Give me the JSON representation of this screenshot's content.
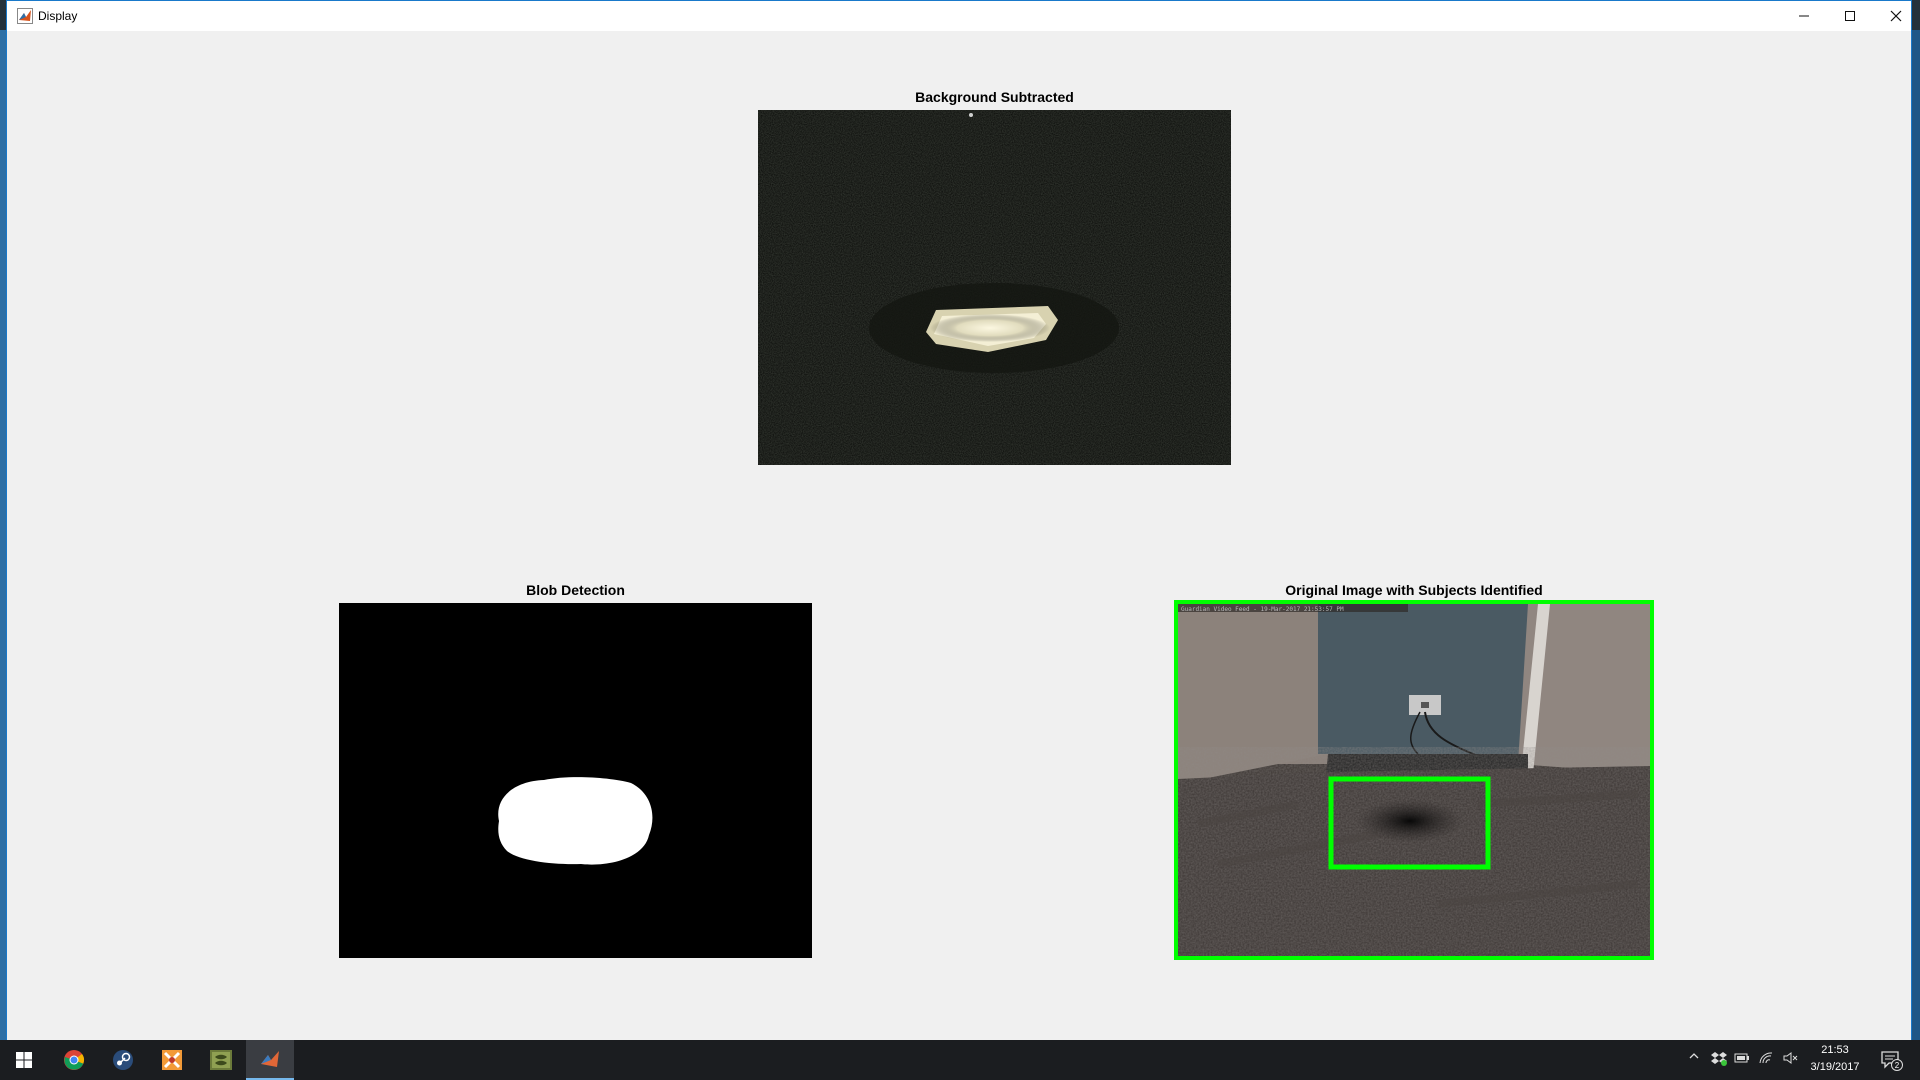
{
  "window": {
    "title": "Display"
  },
  "figure": {
    "panels": {
      "background_subtracted": {
        "title": "Background Subtracted"
      },
      "blob_detection": {
        "title": "Blob Detection"
      },
      "original": {
        "title": "Original Image with Subjects Identified",
        "overlay_text": "Guardian Video Feed - 19-Mar-2017 21:53:57 PM"
      }
    },
    "highlight_color": "#00ff00"
  },
  "taskbar": {
    "apps": [
      "start-icon",
      "chrome-icon",
      "steam-icon",
      "app-orange-icon",
      "app-green-icon",
      "matlab-icon"
    ],
    "clock": {
      "time": "21:53",
      "date": "3/19/2017"
    },
    "notification_count": "2"
  }
}
